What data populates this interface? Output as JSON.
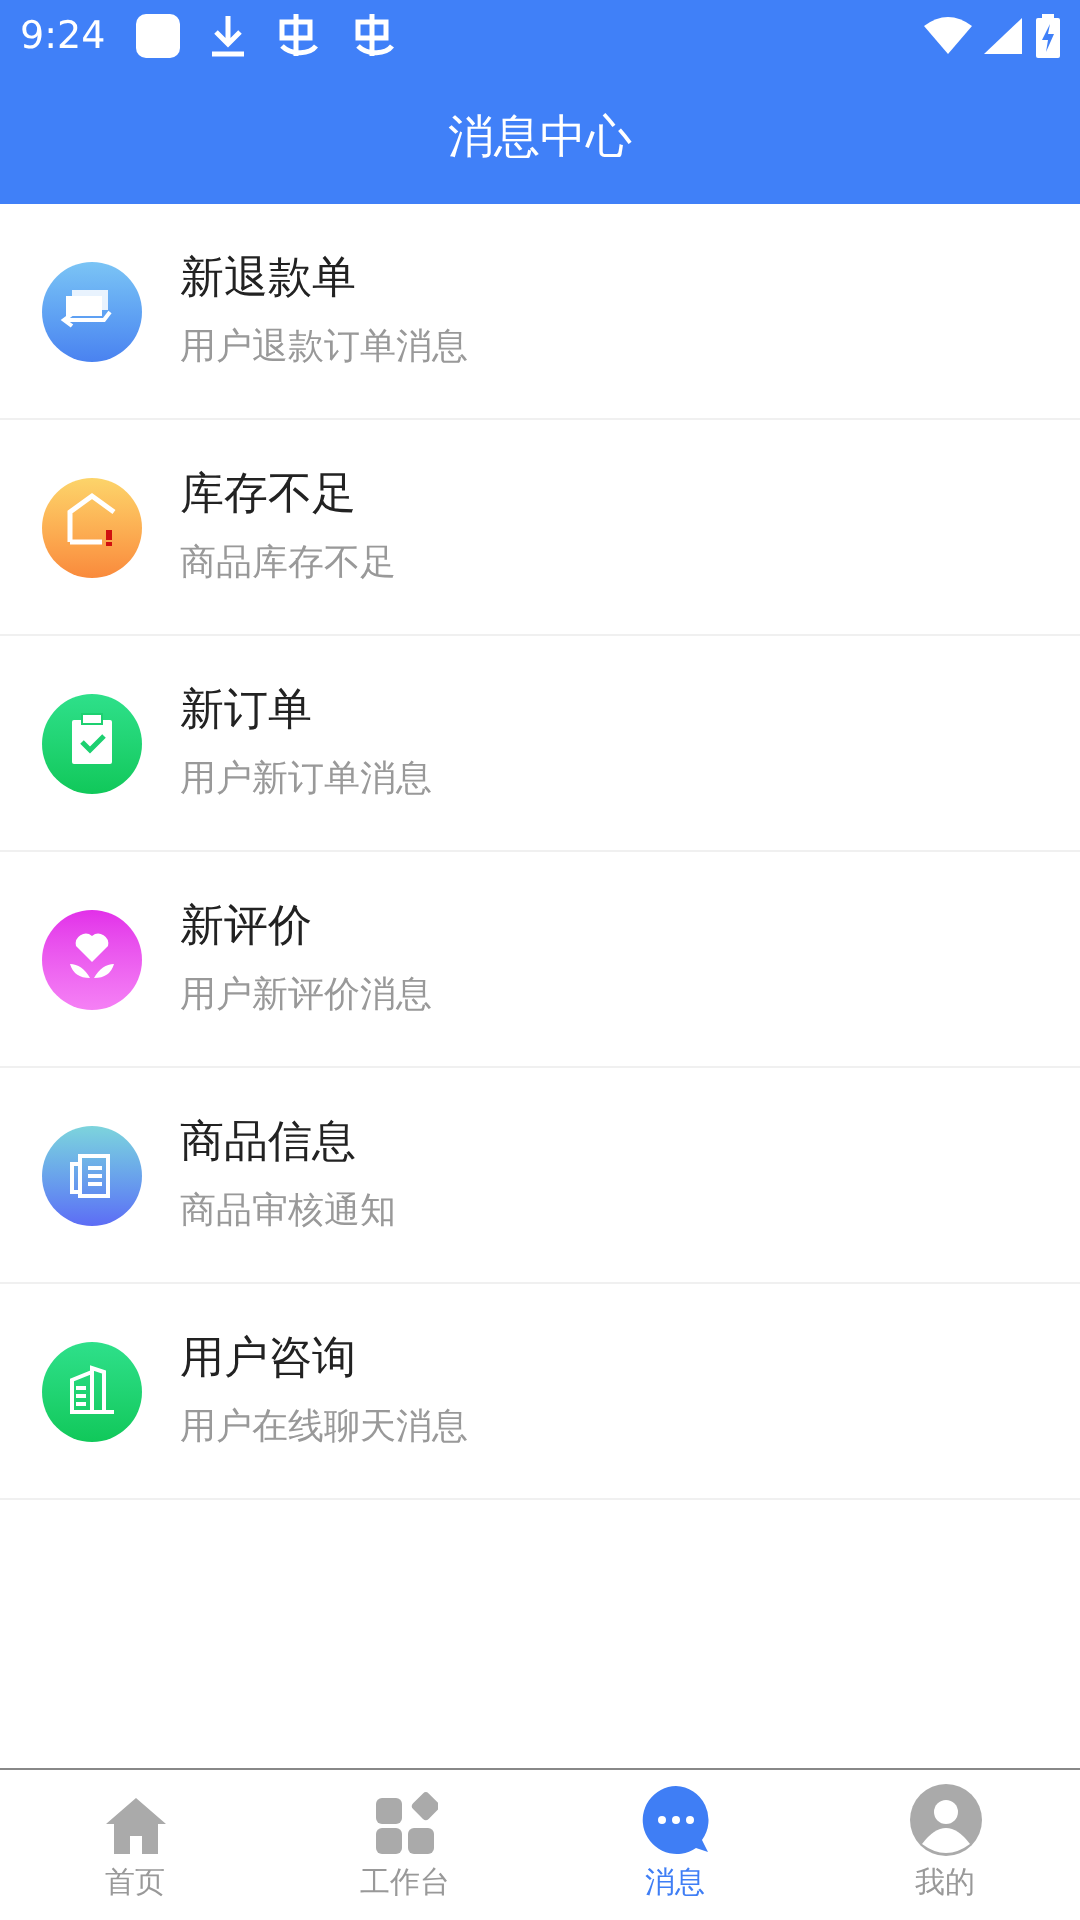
{
  "status_bar": {
    "time": "9:24"
  },
  "header": {
    "title": "消息中心"
  },
  "messages": [
    {
      "kind": "refund",
      "title": "新退款单",
      "subtitle": "用户退款订单消息"
    },
    {
      "kind": "stock",
      "title": "库存不足",
      "subtitle": "商品库存不足"
    },
    {
      "kind": "order",
      "title": "新订单",
      "subtitle": "用户新订单消息"
    },
    {
      "kind": "review",
      "title": "新评价",
      "subtitle": "用户新评价消息"
    },
    {
      "kind": "product",
      "title": "商品信息",
      "subtitle": "商品审核通知"
    },
    {
      "kind": "consult",
      "title": "用户咨询",
      "subtitle": "用户在线聊天消息"
    }
  ],
  "tab_bar": [
    {
      "kind": "home",
      "label": "首页",
      "selected": false
    },
    {
      "kind": "workbench",
      "label": "工作台",
      "selected": false
    },
    {
      "kind": "messages",
      "label": "消息",
      "selected": true
    },
    {
      "kind": "profile",
      "label": "我的",
      "selected": false
    }
  ]
}
